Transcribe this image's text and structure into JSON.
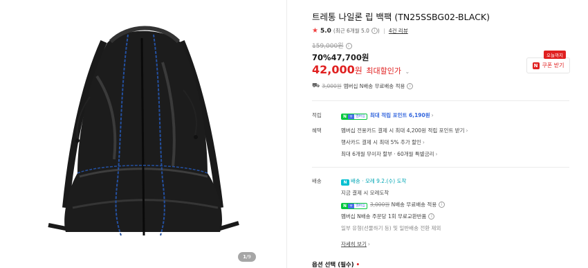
{
  "gallery": {
    "counter_current": "1",
    "counter_total": "/9"
  },
  "product": {
    "title": "트레통 나일론 립 백팩 (TN25SSBG02-BLACK)",
    "rating": "5.0",
    "rating_recent": "(최근 6개월 5.0",
    "rating_recent_close": ")",
    "review_count": "4건 리뷰",
    "original_price": "159,000원",
    "discount_pct": "70%",
    "sale_price": "47,700원",
    "final_price": "42,000",
    "final_won": "원",
    "final_label": "최대할인가",
    "coupon_tag": "오늘까지",
    "coupon_button": "쿠폰 받기",
    "shipping_strike": "3,000원",
    "shipping_text": "멤버십 N배송 무료배송 적용"
  },
  "benefits": {
    "points_label": "적립",
    "points_text": "최대 적립 포인트 6,190원",
    "perks_label": "혜택",
    "perks": [
      "멤버십 전용카드 결제 시 최대 4,200원 적립 포인트 받기",
      "행사카드 결제 시 최대 5% 추가 할인",
      "최대 6개월 무이자 할부 · 60개월 특별금리"
    ]
  },
  "delivery": {
    "label": "배송",
    "badge": "N",
    "type": "배송",
    "eta": "· 모레 9.2.(수) 도착",
    "eta_note": "지금 결제 시 모레도착",
    "fee_strike": "3,000원",
    "fee_text": "N배송 무료배송 적용",
    "exchange": "멤버십 N배송 주문당 1회 무료교환반품",
    "exclusion": "일부 유형(선물하기 등) 및 일반배송 전환 제외",
    "details_link": "자세히 보기"
  },
  "options": {
    "label": "옵션 선택 (필수)",
    "required_mark": "•"
  },
  "badges": {
    "n": "N",
    "plus": "+",
    "member": "멤버십"
  },
  "colors": {
    "accent_red": "#e02020",
    "naver_green": "#00c73c",
    "points_blue": "#3366dd",
    "delivery_teal": "#00a6b4"
  }
}
